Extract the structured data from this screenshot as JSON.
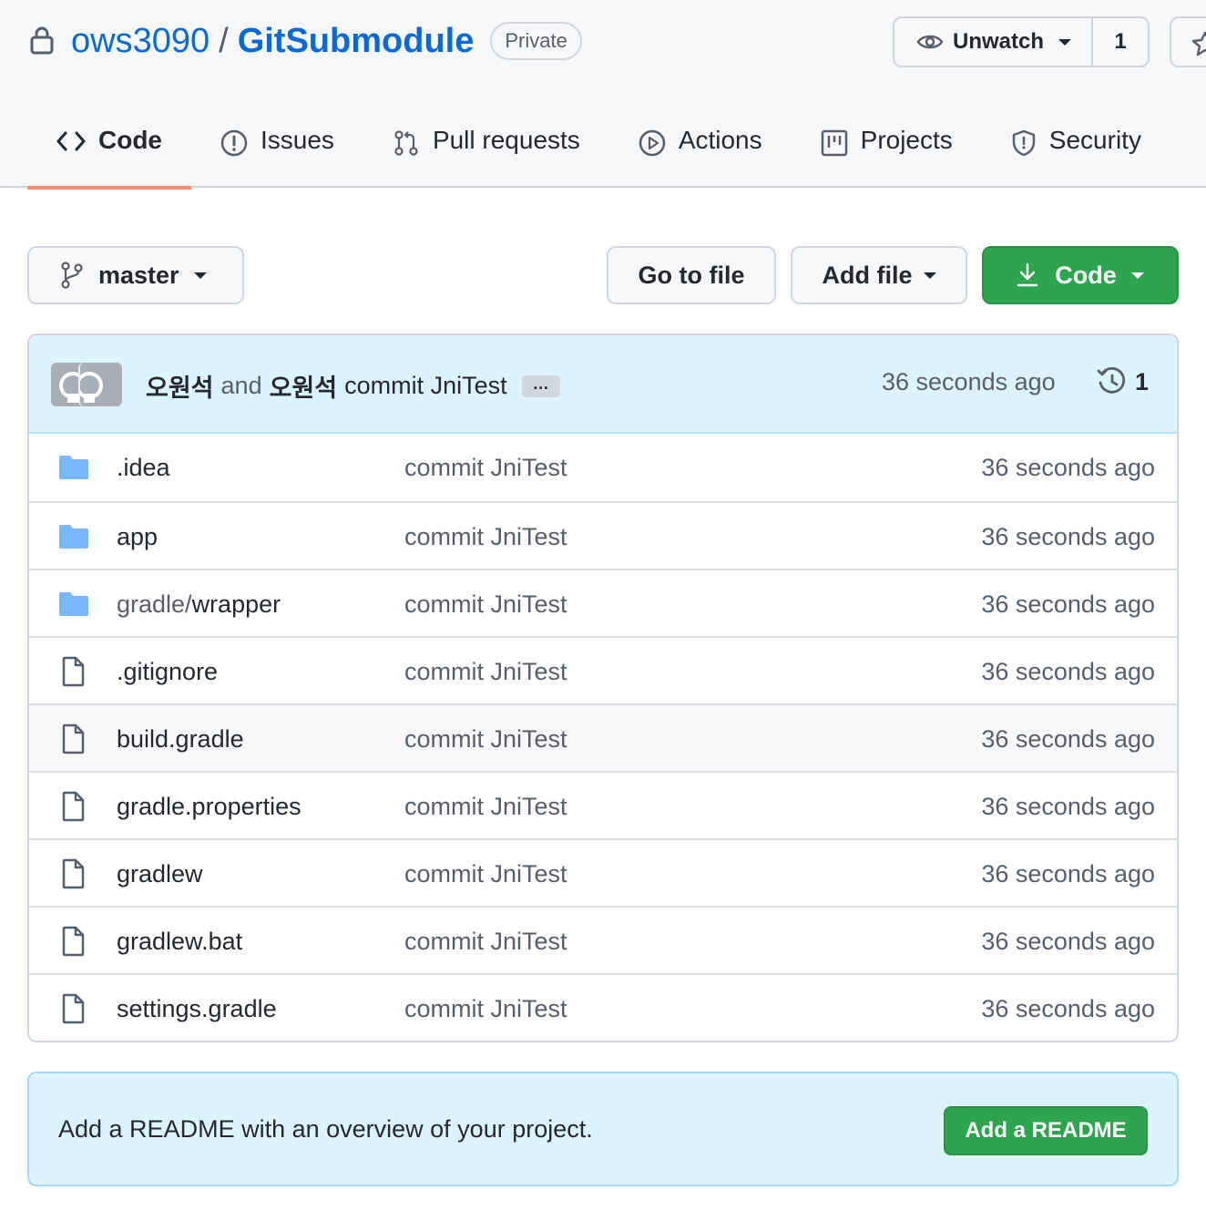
{
  "repo": {
    "owner": "ows3090",
    "separator": "/",
    "name": "GitSubmodule",
    "visibility": "Private"
  },
  "watch": {
    "label": "Unwatch",
    "count": "1"
  },
  "nav": {
    "tabs": [
      {
        "label": "Code",
        "icon": "code-icon",
        "active": true
      },
      {
        "label": "Issues",
        "icon": "issue-icon"
      },
      {
        "label": "Pull requests",
        "icon": "pull-request-icon"
      },
      {
        "label": "Actions",
        "icon": "play-icon"
      },
      {
        "label": "Projects",
        "icon": "project-icon"
      },
      {
        "label": "Security",
        "icon": "shield-icon"
      }
    ]
  },
  "toolbar": {
    "branch": "master",
    "goto_file": "Go to file",
    "add_file": "Add file",
    "code": "Code"
  },
  "commit": {
    "author1": "오원석",
    "conjunction": "and",
    "author2": "오원석",
    "message": "commit JniTest",
    "ellipsis": "…",
    "time": "36 seconds ago",
    "commit_count": "1"
  },
  "files": [
    {
      "prefix": "",
      "name": ".idea",
      "type": "folder",
      "message": "commit JniTest",
      "age": "36 seconds ago"
    },
    {
      "prefix": "",
      "name": "app",
      "type": "folder",
      "message": "commit JniTest",
      "age": "36 seconds ago"
    },
    {
      "prefix": "gradle/",
      "name": "wrapper",
      "type": "folder",
      "message": "commit JniTest",
      "age": "36 seconds ago"
    },
    {
      "prefix": "",
      "name": ".gitignore",
      "type": "file",
      "message": "commit JniTest",
      "age": "36 seconds ago"
    },
    {
      "prefix": "",
      "name": "build.gradle",
      "type": "file",
      "message": "commit JniTest",
      "age": "36 seconds ago"
    },
    {
      "prefix": "",
      "name": "gradle.properties",
      "type": "file",
      "message": "commit JniTest",
      "age": "36 seconds ago"
    },
    {
      "prefix": "",
      "name": "gradlew",
      "type": "file",
      "message": "commit JniTest",
      "age": "36 seconds ago"
    },
    {
      "prefix": "",
      "name": "gradlew.bat",
      "type": "file",
      "message": "commit JniTest",
      "age": "36 seconds ago"
    },
    {
      "prefix": "",
      "name": "settings.gradle",
      "type": "file",
      "message": "commit JniTest",
      "age": "36 seconds ago"
    }
  ],
  "readme": {
    "text": "Add a README with an overview of your project.",
    "button": "Add a README"
  },
  "colors": {
    "link": "#0969da",
    "primary_button": "#2da44e",
    "active_tab_underline": "#fd8c73",
    "folder": "#54aeff",
    "commit_bar": "#ddf4ff"
  }
}
